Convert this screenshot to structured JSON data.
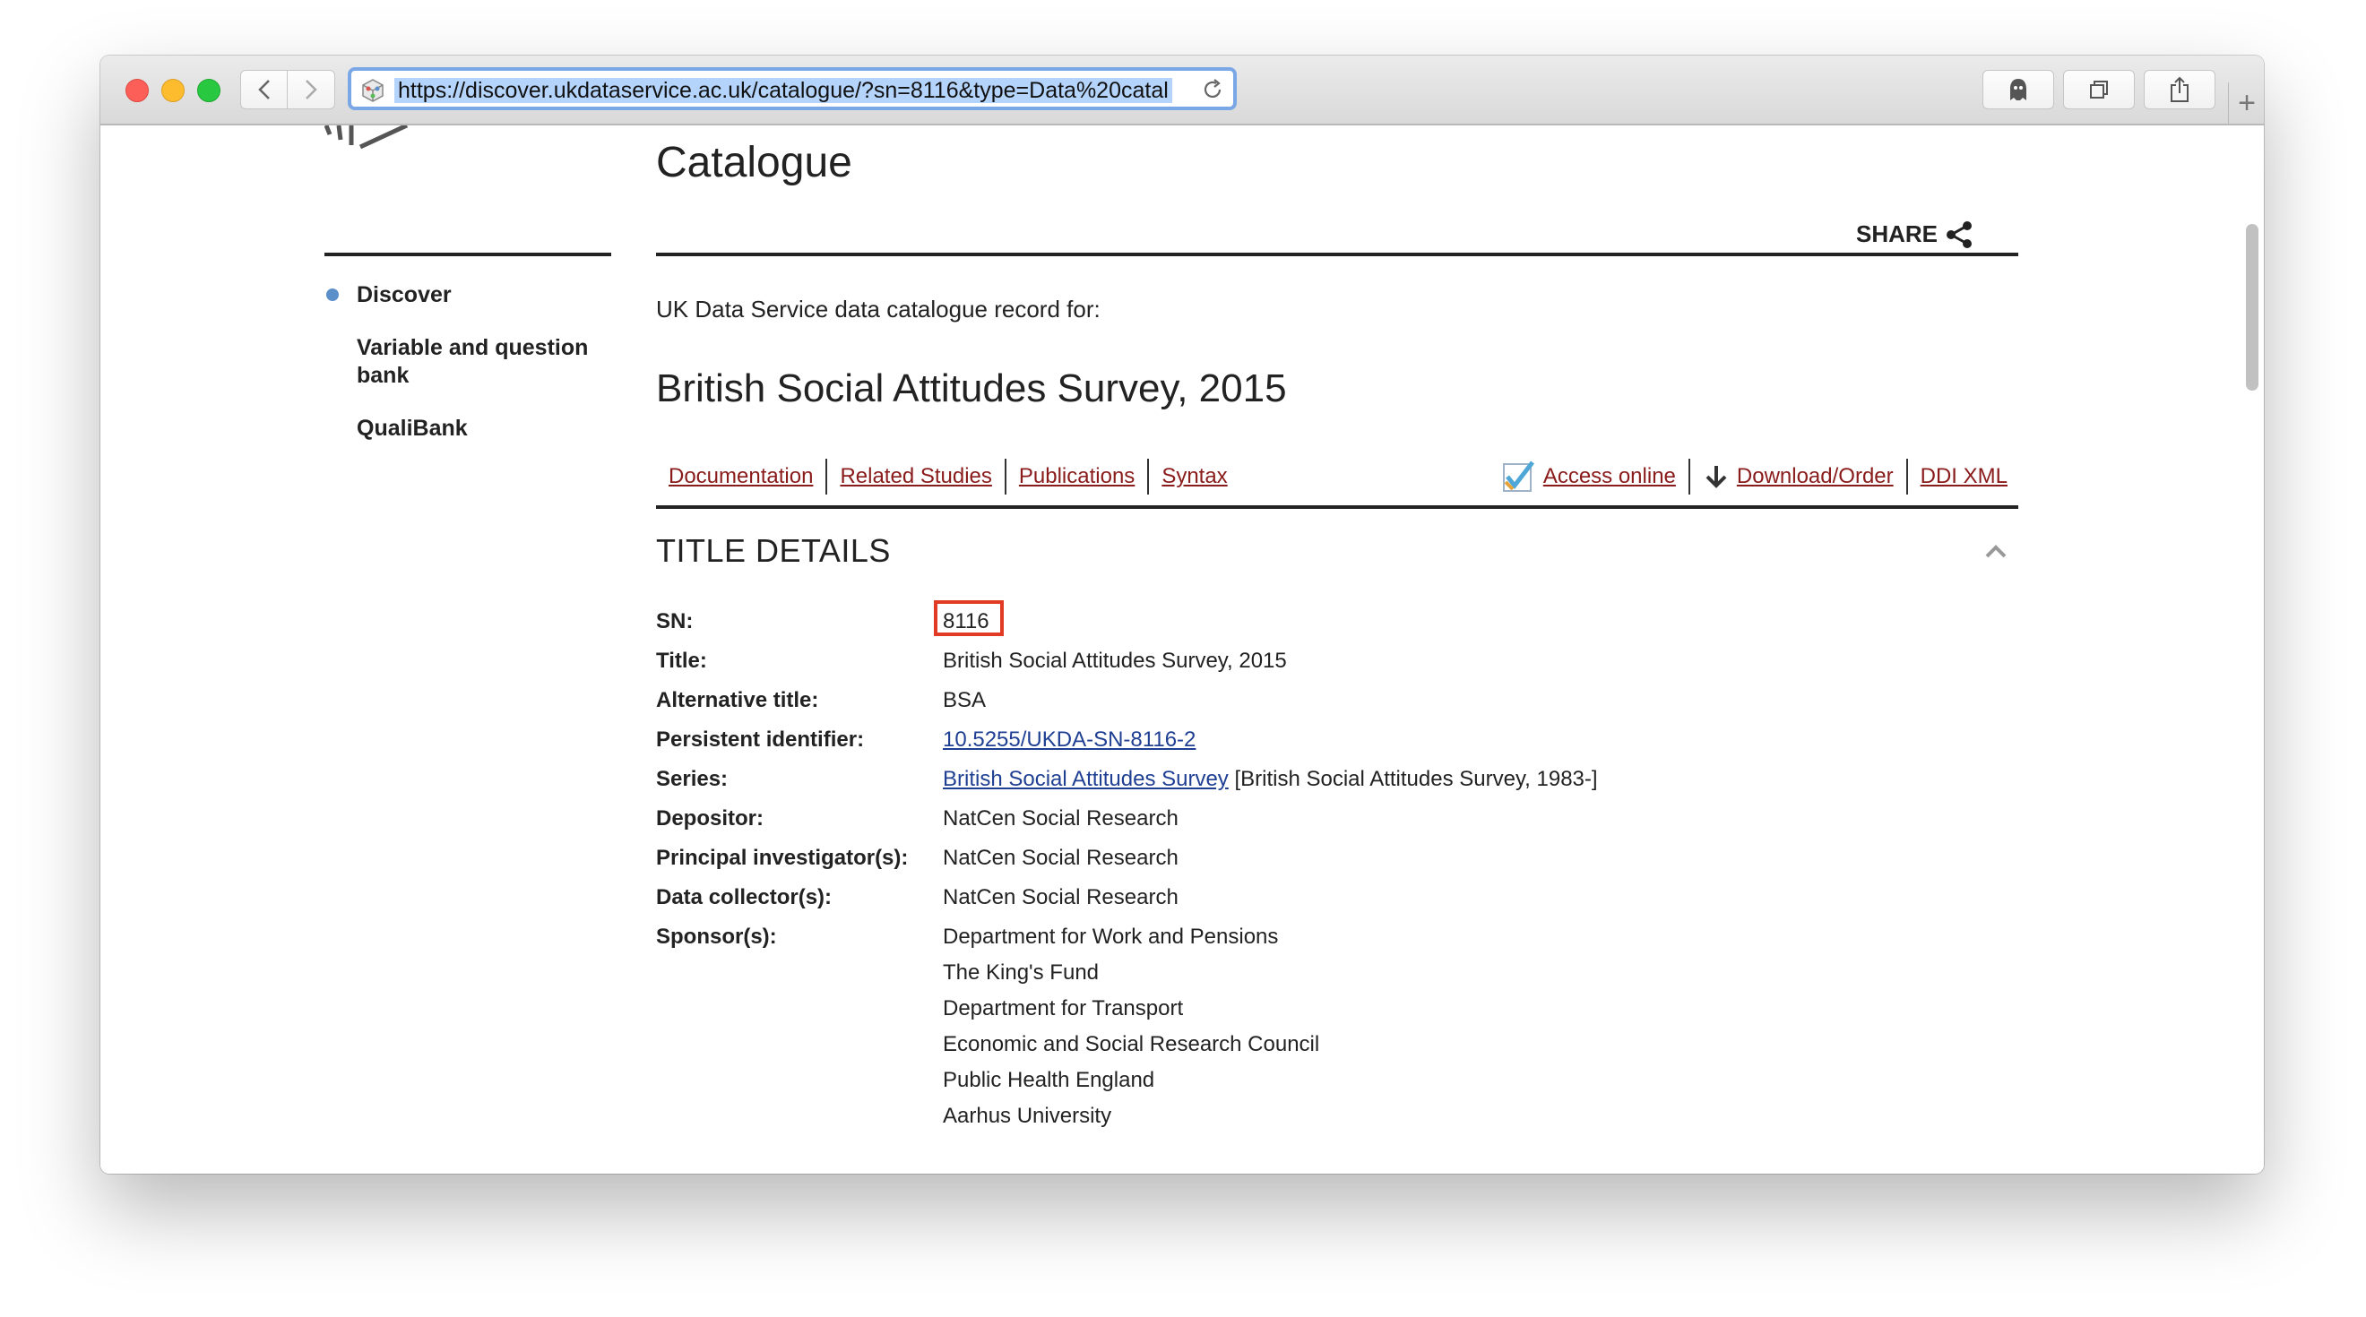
{
  "browser": {
    "url": "https://discover.ukdataservice.ac.uk/catalogue/?sn=8116&type=Data%20catal",
    "new_tab_label": "+"
  },
  "sidebar": {
    "items": [
      {
        "label": "Discover",
        "active": true
      },
      {
        "label": "Variable and question bank",
        "active": false
      },
      {
        "label": "QualiBank",
        "active": false
      }
    ]
  },
  "page": {
    "title": "Catalogue",
    "share_label": "SHARE",
    "record_intro": "UK Data Service data catalogue record for:",
    "study_title": "British Social Attitudes Survey, 2015",
    "links_left": [
      "Documentation",
      "Related Studies",
      "Publications",
      "Syntax"
    ],
    "links_right": [
      "Access online",
      "Download/Order",
      "DDI XML"
    ],
    "section_title": "TITLE DETAILS"
  },
  "details": {
    "sn_label": "SN:",
    "sn": "8116",
    "title_label": "Title:",
    "title": "British Social Attitudes Survey, 2015",
    "alt_title_label": "Alternative title:",
    "alt_title": "BSA",
    "pid_label": "Persistent identifier:",
    "pid": "10.5255/UKDA-SN-8116-2",
    "series_label": "Series:",
    "series_link": "British Social Attitudes Survey",
    "series_extra": " [British Social Attitudes Survey, 1983-]",
    "depositor_label": "Depositor:",
    "depositor": "NatCen Social Research",
    "pi_label": "Principal investigator(s):",
    "pi": "NatCen Social Research",
    "collector_label": "Data collector(s):",
    "collector": "NatCen Social Research",
    "sponsor_label": "Sponsor(s):",
    "sponsors": [
      "Department for Work and Pensions",
      "The King's Fund",
      "Department for Transport",
      "Economic and Social Research Council",
      "Public Health England",
      "Aarhus University"
    ]
  },
  "colors": {
    "link": "#8a1b1b",
    "highlight": "#e13a25",
    "accent_dot": "#5b8fc9"
  }
}
